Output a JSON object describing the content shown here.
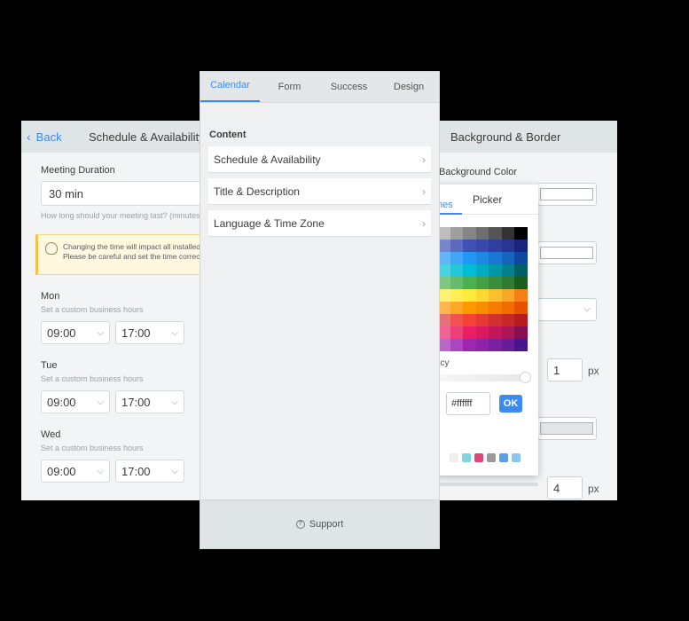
{
  "left_panel": {
    "back_label": "Back",
    "title": "Schedule & Availability",
    "meeting_duration_label": "Meeting Duration",
    "meeting_duration_value": "30 min",
    "meeting_duration_hint": "How long should your meeting last? (minutes)",
    "notice_line1": "Changing the time will impact all installed",
    "notice_line2": "Please be careful and set the time correct",
    "days": [
      {
        "name": "Mon",
        "hint": "Set a custom business hours",
        "start": "09:00",
        "end": "17:00"
      },
      {
        "name": "Tue",
        "hint": "Set a custom business hours",
        "start": "09:00",
        "end": "17:00"
      },
      {
        "name": "Wed",
        "hint": "Set a custom business hours",
        "start": "09:00",
        "end": "17:00"
      }
    ]
  },
  "center_panel": {
    "tabs": [
      "Calendar",
      "Form",
      "Success",
      "Design"
    ],
    "active_tab": "Calendar",
    "section_title": "Content",
    "items": [
      "Schedule & Availability",
      "Title & Description",
      "Language & Time Zone"
    ],
    "support_label": "Support"
  },
  "right_panel": {
    "title": "Background & Border",
    "background_color_label": "Background Color",
    "border_width_value": "1",
    "border_width_unit": "px",
    "radius_value": "4",
    "radius_unit": "px"
  },
  "color_picker": {
    "tab_themes_partial": "nes",
    "tab_picker": "Picker",
    "opacity_label_partial": "ncy",
    "hex_value": "#ffffff",
    "ok_label": "OK",
    "recent_colors": [
      "#eeeeee",
      "#7fd6e0",
      "#e0457b",
      "#9a9a9a",
      "#5a9ee6",
      "#8bc7f0"
    ]
  },
  "colors": {
    "accent": "#3d8bf2",
    "panel_bg": "#f2f4f5",
    "header_bg": "#dfe4e6"
  }
}
